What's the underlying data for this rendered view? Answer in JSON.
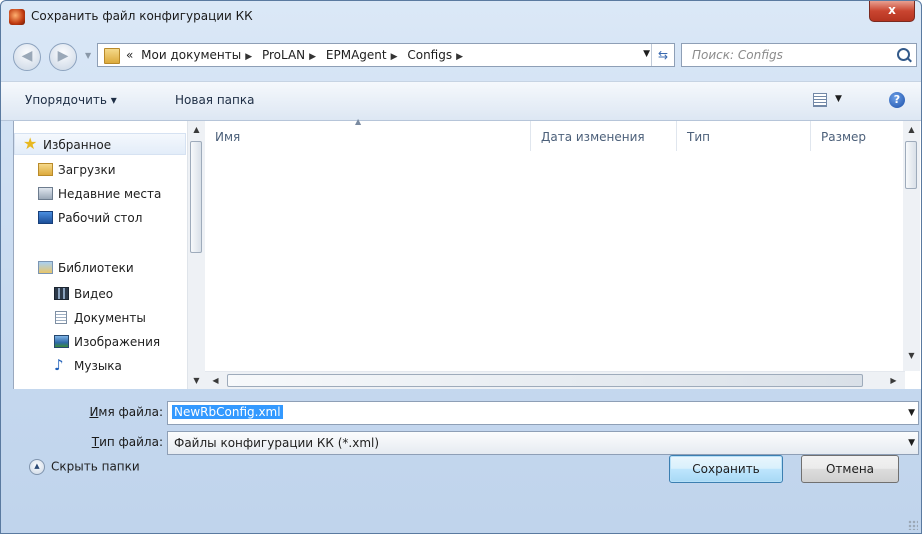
{
  "window": {
    "title": "Сохранить файл конфигурации КК",
    "close_label": "x"
  },
  "address": {
    "crumbs": [
      "«",
      "Мои документы",
      "ProLAN",
      "EPMAgent",
      "Configs"
    ],
    "search_placeholder": "Поиск: Configs"
  },
  "toolbar": {
    "organize_label": "Упорядочить ▾",
    "new_folder_label": "Новая папка"
  },
  "nav": {
    "favorites": "Избранное",
    "downloads": "Загрузки",
    "recent": "Недавние места",
    "desktop": "Рабочий стол",
    "libraries": "Библиотеки",
    "video": "Видео",
    "documents": "Документы",
    "images": "Изображения",
    "music": "Музыка"
  },
  "columns": {
    "name": "Имя",
    "date": "Дата изменения",
    "type": "Тип",
    "size": "Размер"
  },
  "form": {
    "filename_label_u": "И",
    "filename_label_rest": "мя файла:",
    "filename_value": "NewRbConfig.xml",
    "filetype_label_u": "Т",
    "filetype_label_rest": "ип файла:",
    "filetype_value": "Файлы конфигурации КК (*.xml)"
  },
  "footer": {
    "hide_folders": "Скрыть папки",
    "save": "Сохранить",
    "cancel": "Отмена"
  },
  "colors": {
    "selection": "#3399ff",
    "title_bar": "#c6d9ef",
    "close": "#c94530"
  }
}
